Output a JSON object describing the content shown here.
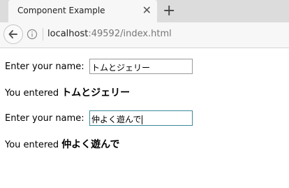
{
  "browser": {
    "tab_title": "Component Example",
    "tab_close": "✕",
    "new_tab": "+",
    "url_host": "localhost",
    "url_rest": ":49592/index.html"
  },
  "page": {
    "field1": {
      "label": "Enter your name:",
      "value": "トムとジェリー"
    },
    "echo1": {
      "prefix": "You entered",
      "value": "トムとジェリー"
    },
    "field2": {
      "label": "Enter your name:",
      "value": "仲よく遊んで"
    },
    "echo2": {
      "prefix": "You entered",
      "value": "仲よく遊んで"
    }
  }
}
